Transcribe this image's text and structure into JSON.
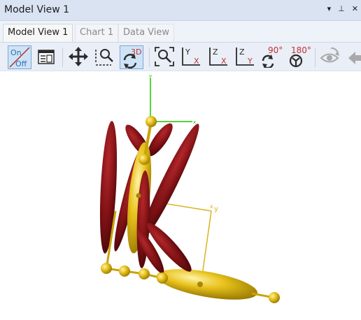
{
  "window": {
    "title": "Model View 1",
    "dropdown_glyph": "▾",
    "pin_glyph": "⊥",
    "close_glyph": "✕"
  },
  "tabs": [
    {
      "label": "Model View 1",
      "active": true
    },
    {
      "label": "Chart 1",
      "active": false
    },
    {
      "label": "Data View",
      "active": false
    }
  ],
  "toolbar": {
    "on_off": {
      "on": "On",
      "off": "Off"
    },
    "rotate3d_label": "3D",
    "axis_views": [
      {
        "up": "Y",
        "right": "X"
      },
      {
        "up": "Z",
        "right": "X"
      },
      {
        "up": "Z",
        "right": "Y"
      }
    ],
    "rotate90_label": "90°",
    "rotate180_label": "180°"
  },
  "icons": [
    "close-icon",
    "pin-icon",
    "on-off-toggle-icon",
    "properties-icon",
    "pan-icon",
    "zoom-box-icon",
    "rotate-3d-icon",
    "zoom-fit-icon",
    "view-yx-icon",
    "view-zx-icon",
    "view-zy-icon",
    "rotate-90-icon",
    "rotate-180-icon",
    "visibility-icon",
    "back-arrow-icon"
  ],
  "viewport": {
    "axis_labels": {
      "y": "y",
      "x": "x"
    },
    "colors": {
      "bone": "#e0b90a",
      "muscle": "#7d1114",
      "axis_green": "#21c400",
      "frame": "#d9b41c"
    }
  }
}
